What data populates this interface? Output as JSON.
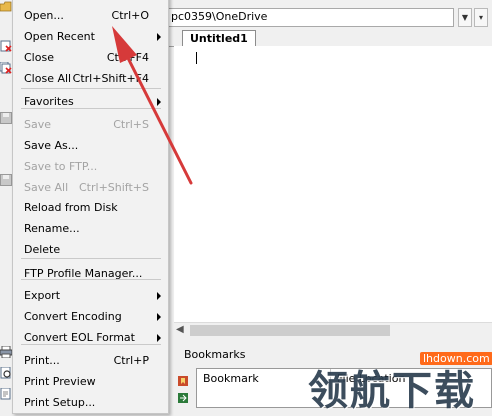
{
  "editor": {
    "path_value": "pc0359\\OneDrive",
    "doc_tab": "Untitled1",
    "bookmarks_title": "Bookmarks",
    "bookmark_col": "Bookmark",
    "file_location_col": "File Location"
  },
  "file_menu": {
    "items": [
      {
        "label": "Open...",
        "shortcut": "Ctrl+O",
        "submenu": false,
        "disabled": false
      },
      {
        "label": "Open Recent",
        "shortcut": "",
        "submenu": true,
        "disabled": false
      },
      {
        "label": "Close",
        "shortcut": "Ctrl+F4",
        "submenu": false,
        "disabled": false
      },
      {
        "label": "Close All",
        "shortcut": "Ctrl+Shift+F4",
        "submenu": false,
        "disabled": false
      },
      {
        "label": "Favorites",
        "shortcut": "",
        "submenu": true,
        "disabled": false
      },
      {
        "label": "Save",
        "shortcut": "Ctrl+S",
        "submenu": false,
        "disabled": true
      },
      {
        "label": "Save As...",
        "shortcut": "",
        "submenu": false,
        "disabled": false
      },
      {
        "label": "Save to FTP...",
        "shortcut": "",
        "submenu": false,
        "disabled": true
      },
      {
        "label": "Save All",
        "shortcut": "Ctrl+Shift+S",
        "submenu": false,
        "disabled": true
      },
      {
        "label": "Reload from Disk",
        "shortcut": "",
        "submenu": false,
        "disabled": false
      },
      {
        "label": "Rename...",
        "shortcut": "",
        "submenu": false,
        "disabled": false
      },
      {
        "label": "Delete",
        "shortcut": "",
        "submenu": false,
        "disabled": false
      },
      {
        "label": "FTP Profile Manager...",
        "shortcut": "",
        "submenu": false,
        "disabled": false
      },
      {
        "label": "Export",
        "shortcut": "",
        "submenu": true,
        "disabled": false
      },
      {
        "label": "Convert Encoding",
        "shortcut": "",
        "submenu": true,
        "disabled": false
      },
      {
        "label": "Convert EOL Format",
        "shortcut": "",
        "submenu": true,
        "disabled": false
      },
      {
        "label": "Print...",
        "shortcut": "Ctrl+P",
        "submenu": false,
        "disabled": false
      },
      {
        "label": "Print Preview",
        "shortcut": "",
        "submenu": false,
        "disabled": false
      },
      {
        "label": "Print Setup...",
        "shortcut": "",
        "submenu": false,
        "disabled": false
      }
    ]
  },
  "watermark": {
    "text": "领航下载",
    "url": "lhdown.com"
  },
  "colors": {
    "annotation_arrow": "#d63a3a",
    "menu_bg": "#f2f2f2",
    "disabled_text": "#a3a3a3"
  }
}
